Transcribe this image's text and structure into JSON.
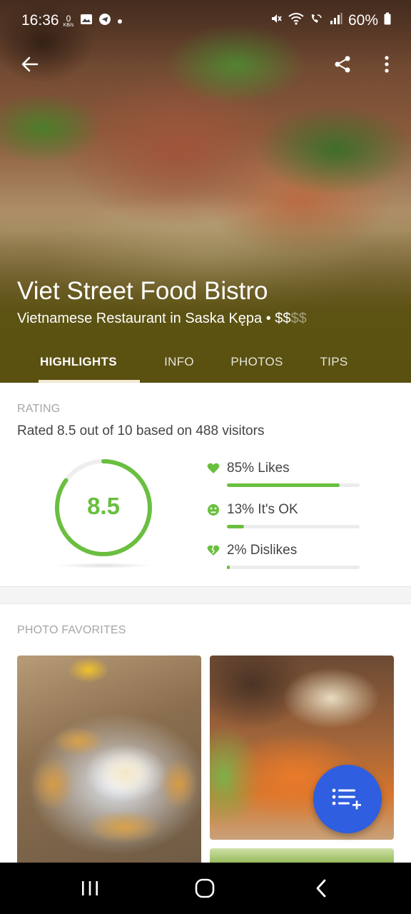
{
  "status_bar": {
    "time": "16:36",
    "net_speed_value": "0",
    "net_speed_unit": "KB/s",
    "battery": "60%"
  },
  "hero": {
    "venue_name": "Viet Street Food Bistro",
    "subtitle": "Vietnamese Restaurant in Saska Kępa • ",
    "price_active": "$$",
    "price_inactive": "$$"
  },
  "tabs": [
    {
      "label": "HIGHLIGHTS",
      "active": true
    },
    {
      "label": "INFO",
      "active": false
    },
    {
      "label": "PHOTOS",
      "active": false
    },
    {
      "label": "TIPS",
      "active": false
    }
  ],
  "rating": {
    "section_label": "RATING",
    "summary": "Rated 8.5 out of 10 based on 488 visitors",
    "score": "8.5",
    "score_fraction": 0.85,
    "accent_color": "#6abf40",
    "stats": [
      {
        "label": "85% Likes",
        "percent": 85,
        "icon": "heart-icon"
      },
      {
        "label": "13% It's OK",
        "percent": 13,
        "icon": "neutral-face-icon"
      },
      {
        "label": "2% Dislikes",
        "percent": 2,
        "icon": "broken-heart-icon"
      }
    ]
  },
  "photos": {
    "section_label": "PHOTO FAVORITES"
  },
  "fab": {
    "icon": "add-to-list-icon",
    "color": "#2f5fe0"
  }
}
